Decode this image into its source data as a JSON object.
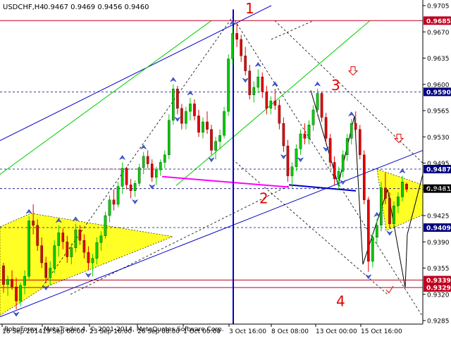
{
  "header": {
    "symbol": "USDCHF,H4",
    "ohlc": "0.9467 0.9469 0.9456 0.9460"
  },
  "footer": {
    "copyright": "RoboForex - MetaTrader 4, © 2001-2014, MetaQuotes Software Corp."
  },
  "colors": {
    "background": "#ffffff",
    "bull": "#00cc00",
    "bear": "#e00000",
    "level_marker": "#c00020",
    "hline": "#000080",
    "pink_line": "#ff00ff",
    "annotation": "#e00000",
    "triangle_fill": "#ffff00",
    "grid": "#c0c0c0",
    "trend_green": "#00cc00",
    "trend_blue": "#0000cc",
    "vertical_line": "#0000cc"
  },
  "chart_data": {
    "type": "candlestick",
    "title": "USDCHF,H4",
    "ylim": [
      0.9285,
      0.9705
    ],
    "y_ticks": [
      "0.9705",
      "0.9670",
      "0.9635",
      "0.9600",
      "0.9565",
      "0.9530",
      "0.9495",
      "0.9460",
      "0.9425",
      "0.9390",
      "0.9355",
      "0.9320",
      "0.9285"
    ],
    "x_ticks": [
      "16 Sep 2014",
      "19 Sep 00:00",
      "23 Sep 16:00",
      "26 Sep 08:00",
      "1 Oct 00:00",
      "3 Oct 16:00",
      "8 Oct 08:00",
      "13 Oct 00:00",
      "15 Oct 16:00"
    ],
    "horizontal_levels": [
      {
        "value": 0.9685,
        "label": "0.9685",
        "style": "solid",
        "color": "#c00020"
      },
      {
        "value": 0.959,
        "label": "0.9590",
        "style": "dashed",
        "color": "#000080"
      },
      {
        "value": 0.9487,
        "label": "0.9487",
        "style": "dashed",
        "color": "#000080"
      },
      {
        "value": 0.9461,
        "label": "0.9461",
        "style": "dashed",
        "color": "#000080"
      },
      {
        "value": 0.9409,
        "label": "0.9409",
        "style": "dashed",
        "color": "#000080"
      },
      {
        "value": 0.9339,
        "label": "0.9339",
        "style": "solid",
        "color": "#c00020"
      },
      {
        "value": 0.9329,
        "label": "0.9329",
        "style": "solid",
        "color": "#c00020"
      }
    ],
    "current_price": "0.9461",
    "annotations": [
      "1",
      "2",
      "3",
      "4"
    ],
    "candles": [
      [
        0.9358,
        0.9362,
        0.9322,
        0.9333
      ],
      [
        0.9333,
        0.9345,
        0.9318,
        0.934
      ],
      [
        0.934,
        0.9352,
        0.9326,
        0.933
      ],
      [
        0.933,
        0.9342,
        0.93,
        0.9311
      ],
      [
        0.9311,
        0.9336,
        0.9304,
        0.9332
      ],
      [
        0.9332,
        0.9352,
        0.932,
        0.9344
      ],
      [
        0.9344,
        0.9424,
        0.934,
        0.9418
      ],
      [
        0.9418,
        0.944,
        0.94,
        0.9412
      ],
      [
        0.9412,
        0.942,
        0.9378,
        0.9385
      ],
      [
        0.9385,
        0.9396,
        0.9355,
        0.9362
      ],
      [
        0.9362,
        0.937,
        0.9335,
        0.9342
      ],
      [
        0.9342,
        0.9364,
        0.9332,
        0.9355
      ],
      [
        0.9355,
        0.9392,
        0.9348,
        0.9385
      ],
      [
        0.9385,
        0.9412,
        0.937,
        0.9402
      ],
      [
        0.9402,
        0.9408,
        0.938,
        0.939
      ],
      [
        0.939,
        0.9398,
        0.9362,
        0.937
      ],
      [
        0.937,
        0.9388,
        0.936,
        0.9382
      ],
      [
        0.9382,
        0.9414,
        0.9376,
        0.9406
      ],
      [
        0.9406,
        0.9412,
        0.9386,
        0.9392
      ],
      [
        0.9392,
        0.94,
        0.9368,
        0.9376
      ],
      [
        0.9376,
        0.9384,
        0.9352,
        0.9362
      ],
      [
        0.9362,
        0.9374,
        0.9344,
        0.9368
      ],
      [
        0.9368,
        0.9396,
        0.936,
        0.9389
      ],
      [
        0.9389,
        0.9404,
        0.9378,
        0.9398
      ],
      [
        0.9398,
        0.943,
        0.9394,
        0.9425
      ],
      [
        0.9425,
        0.9452,
        0.9416,
        0.9446
      ],
      [
        0.9446,
        0.946,
        0.9432,
        0.944
      ],
      [
        0.944,
        0.947,
        0.9436,
        0.9464
      ],
      [
        0.9464,
        0.9496,
        0.9454,
        0.9488
      ],
      [
        0.9488,
        0.949,
        0.946,
        0.9466
      ],
      [
        0.9466,
        0.9474,
        0.9448,
        0.9458
      ],
      [
        0.9458,
        0.9472,
        0.945,
        0.9468
      ],
      [
        0.9468,
        0.9494,
        0.9464,
        0.9489
      ],
      [
        0.9489,
        0.951,
        0.948,
        0.9504
      ],
      [
        0.9504,
        0.9512,
        0.9488,
        0.9494
      ],
      [
        0.9494,
        0.95,
        0.947,
        0.9476
      ],
      [
        0.9476,
        0.949,
        0.9466,
        0.9486
      ],
      [
        0.9486,
        0.95,
        0.9478,
        0.9496
      ],
      [
        0.9496,
        0.9512,
        0.9488,
        0.9506
      ],
      [
        0.9506,
        0.956,
        0.95,
        0.9552
      ],
      [
        0.9552,
        0.96,
        0.9546,
        0.9594
      ],
      [
        0.9594,
        0.9598,
        0.956,
        0.9568
      ],
      [
        0.9568,
        0.9574,
        0.954,
        0.9548
      ],
      [
        0.9548,
        0.957,
        0.954,
        0.9564
      ],
      [
        0.9564,
        0.9582,
        0.9552,
        0.9574
      ],
      [
        0.9574,
        0.958,
        0.9552,
        0.9558
      ],
      [
        0.9558,
        0.9566,
        0.953,
        0.9536
      ],
      [
        0.9536,
        0.9556,
        0.9528,
        0.955
      ],
      [
        0.955,
        0.9564,
        0.9534,
        0.954
      ],
      [
        0.954,
        0.9546,
        0.9506,
        0.9512
      ],
      [
        0.9512,
        0.953,
        0.95,
        0.9524
      ],
      [
        0.9524,
        0.954,
        0.9514,
        0.9532
      ],
      [
        0.9532,
        0.957,
        0.9528,
        0.9564
      ],
      [
        0.9564,
        0.964,
        0.9558,
        0.9634
      ],
      [
        0.9634,
        0.9676,
        0.9626,
        0.9668
      ],
      [
        0.9668,
        0.9682,
        0.965,
        0.966
      ],
      [
        0.966,
        0.9666,
        0.963,
        0.9638
      ],
      [
        0.9638,
        0.965,
        0.9612,
        0.9618
      ],
      [
        0.9618,
        0.9626,
        0.958,
        0.9586
      ],
      [
        0.9586,
        0.9604,
        0.9576,
        0.9596
      ],
      [
        0.9596,
        0.962,
        0.9588,
        0.961
      ],
      [
        0.961,
        0.9616,
        0.9582,
        0.959
      ],
      [
        0.959,
        0.9598,
        0.956,
        0.9568
      ],
      [
        0.9568,
        0.9584,
        0.956,
        0.9578
      ],
      [
        0.9578,
        0.9594,
        0.9566,
        0.9572
      ],
      [
        0.9572,
        0.958,
        0.954,
        0.9548
      ],
      [
        0.9548,
        0.9556,
        0.951,
        0.9518
      ],
      [
        0.9518,
        0.9526,
        0.947,
        0.9478
      ],
      [
        0.9478,
        0.9496,
        0.9462,
        0.949
      ],
      [
        0.949,
        0.952,
        0.9484,
        0.9514
      ],
      [
        0.9514,
        0.954,
        0.9506,
        0.9534
      ],
      [
        0.9534,
        0.9548,
        0.952,
        0.9528
      ],
      [
        0.9528,
        0.9552,
        0.952,
        0.9546
      ],
      [
        0.9546,
        0.9572,
        0.9538,
        0.9566
      ],
      [
        0.9566,
        0.9594,
        0.9558,
        0.9588
      ],
      [
        0.9588,
        0.959,
        0.955,
        0.9556
      ],
      [
        0.9556,
        0.9562,
        0.952,
        0.9528
      ],
      [
        0.9528,
        0.9534,
        0.949,
        0.9496
      ],
      [
        0.9496,
        0.9504,
        0.9466,
        0.9474
      ],
      [
        0.9474,
        0.949,
        0.946,
        0.9484
      ],
      [
        0.9484,
        0.9512,
        0.9476,
        0.9506
      ],
      [
        0.9506,
        0.9534,
        0.9498,
        0.9528
      ],
      [
        0.9528,
        0.9554,
        0.952,
        0.9548
      ],
      [
        0.9548,
        0.9564,
        0.953,
        0.954
      ],
      [
        0.954,
        0.9546,
        0.95,
        0.9506
      ],
      [
        0.9506,
        0.9512,
        0.944,
        0.9446
      ],
      [
        0.9446,
        0.945,
        0.935,
        0.9364
      ],
      [
        0.9364,
        0.9402,
        0.9356,
        0.9396
      ],
      [
        0.9396,
        0.942,
        0.9386,
        0.9412
      ],
      [
        0.9412,
        0.947,
        0.9404,
        0.9462
      ],
      [
        0.9462,
        0.9482,
        0.944,
        0.9448
      ],
      [
        0.9448,
        0.9456,
        0.9408,
        0.9414
      ],
      [
        0.9414,
        0.9444,
        0.9408,
        0.9438
      ],
      [
        0.9438,
        0.9456,
        0.9428,
        0.945
      ],
      [
        0.945,
        0.9478,
        0.9444,
        0.947
      ],
      [
        0.9467,
        0.9469,
        0.9456,
        0.946
      ]
    ]
  }
}
